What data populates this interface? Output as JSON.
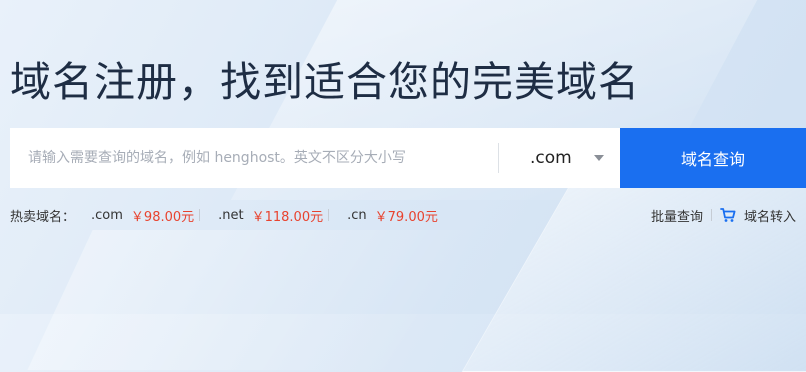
{
  "hero": {
    "title": "域名注册，找到适合您的完美域名"
  },
  "search": {
    "placeholder": "请输入需要查询的域名，例如 henghost。英文不区分大小写",
    "selected_tld": ".com",
    "button_label": "域名查询"
  },
  "hot": {
    "label": "热卖域名：",
    "items": [
      {
        "tld": ".com",
        "price": "￥98.00元"
      },
      {
        "tld": ".net",
        "price": "￥118.00元"
      },
      {
        "tld": ".cn",
        "price": "￥79.00元"
      }
    ]
  },
  "tools": {
    "bulk_query": "批量查询",
    "transfer": "域名转入",
    "cart_icon": "cart-icon"
  },
  "colors": {
    "accent": "#1a6ff0",
    "price": "#e8432f",
    "title": "#1e2d44"
  }
}
